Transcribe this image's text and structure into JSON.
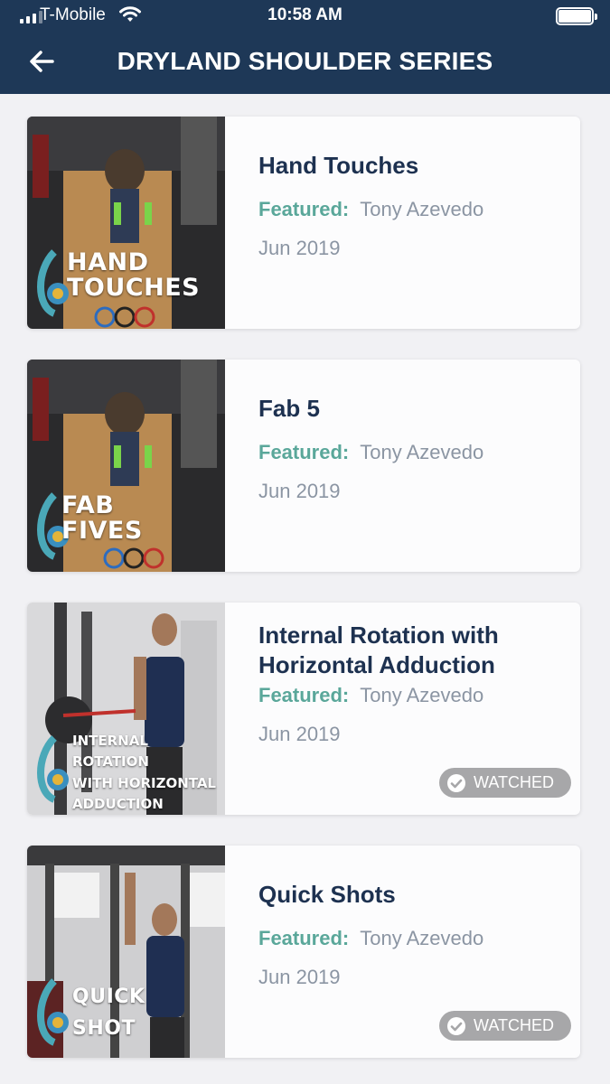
{
  "status_bar": {
    "carrier": "T-Mobile",
    "time": "10:58 AM"
  },
  "nav": {
    "title": "DRYLAND SHOULDER SERIES"
  },
  "videos": [
    {
      "title": "Hand Touches",
      "featured_label": "Featured:",
      "featured_name": "Tony Azevedo",
      "date": "Jun 2019",
      "thumb_caption_line1": "HAND",
      "thumb_caption_line2": "TOUCHES"
    },
    {
      "title": "Fab 5",
      "featured_label": "Featured:",
      "featured_name": "Tony Azevedo",
      "date": "Jun 2019",
      "thumb_caption_line1": "FAB",
      "thumb_caption_line2": "FIVES"
    },
    {
      "title": "Internal Rotation with Horizontal Adduction",
      "featured_label": "Featured:",
      "featured_name": "Tony Azevedo",
      "date": "Jun 2019",
      "thumb_caption_line1": "INTERNAL ROTATION",
      "thumb_caption_line2": "WITH HORIZONTAL",
      "thumb_caption_line3": "ADDUCTION",
      "watched_label": "WATCHED"
    },
    {
      "title": "Quick Shots",
      "featured_label": "Featured:",
      "featured_name": "Tony Azevedo",
      "date": "Jun 2019",
      "thumb_caption_line1": "QUICK",
      "thumb_caption_line2": "SHOT",
      "watched_label": "WATCHED"
    }
  ],
  "colors": {
    "header_bg": "#1e3857",
    "title_text": "#1d3150",
    "featured_accent": "#5aa79a",
    "muted_text": "#8b95a3",
    "watched_badge": "#a7a7a9"
  },
  "icons": {
    "back": "arrow-left-icon",
    "watched": "check-circle-icon",
    "wifi": "wifi-icon",
    "battery": "battery-icon",
    "signal": "signal-icon"
  }
}
